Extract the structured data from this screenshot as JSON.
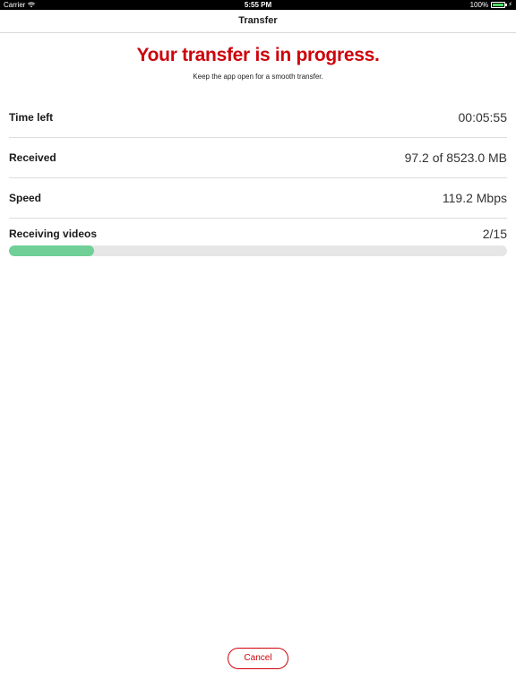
{
  "status_bar": {
    "carrier": "Carrier",
    "time": "5:55 PM",
    "battery": "100%",
    "battery_level": 1.0,
    "battery_color": "#4cd964"
  },
  "nav": {
    "title": "Transfer"
  },
  "header": {
    "headline": "Your transfer is in progress.",
    "subtext": "Keep the app open for a smooth transfer.",
    "headline_color": "#cd040b"
  },
  "rows": [
    {
      "label": "Time left",
      "value": "00:05:55"
    },
    {
      "label": "Received",
      "value": "97.2 of 8523.0 MB"
    },
    {
      "label": "Speed",
      "value": "119.2 Mbps"
    }
  ],
  "progress": {
    "label": "Receiving videos",
    "count": "2/15",
    "fraction": 0.17,
    "fill_color": "#6fcf97"
  },
  "footer": {
    "cancel_label": "Cancel"
  },
  "icons": {
    "wifi": "wifi-icon",
    "battery": "battery-icon",
    "charging": "charging-bolt-icon"
  }
}
